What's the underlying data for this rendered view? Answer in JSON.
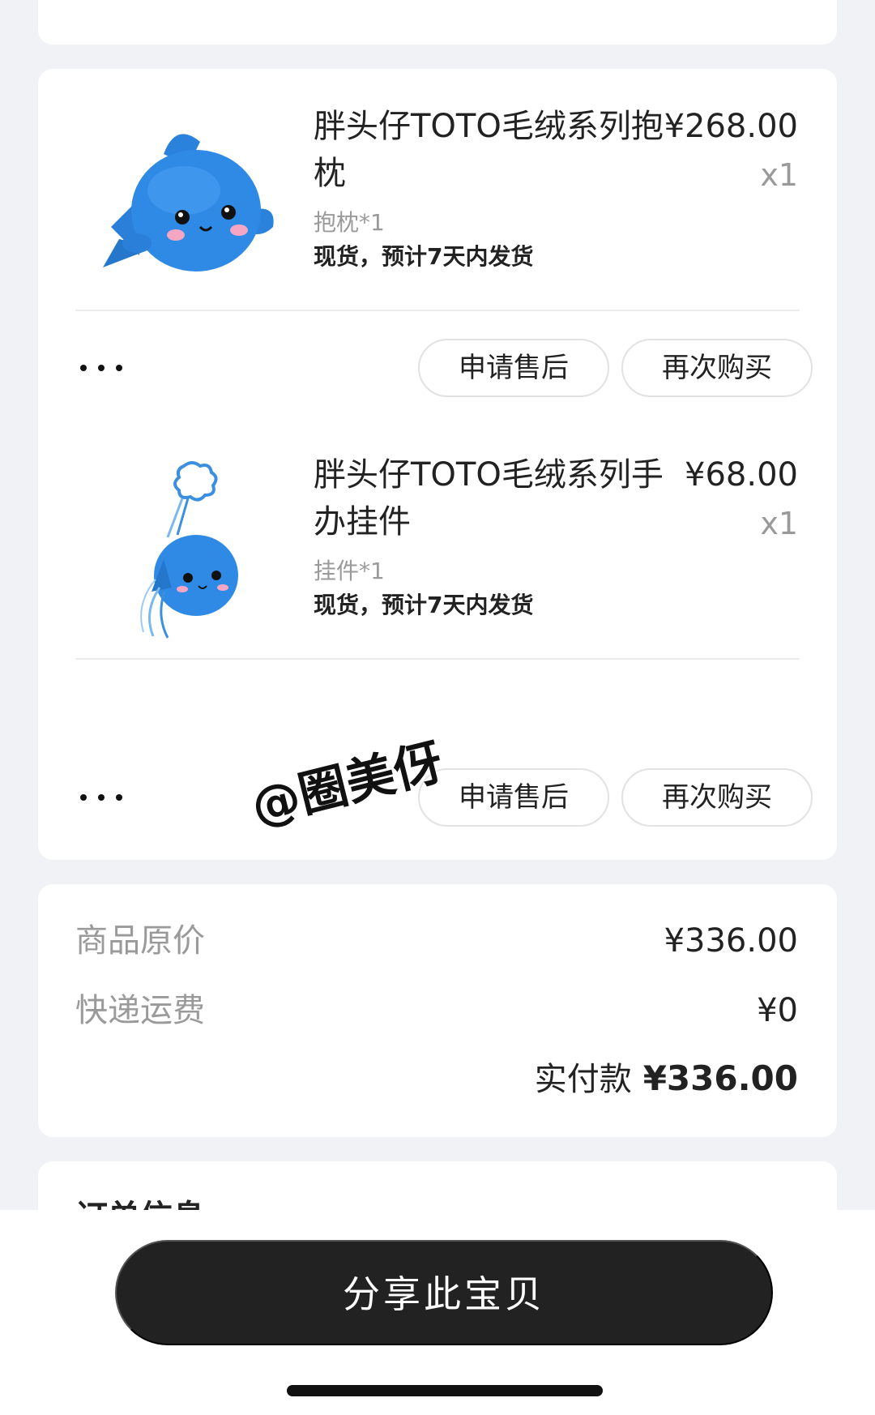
{
  "items": [
    {
      "title": "胖头仔TOTO毛绒系列抱枕",
      "price": "¥268.00",
      "qty": "x1",
      "sku": "抱枕*1",
      "shipping": "现货，预计7天内发货",
      "thumb_icon": "blue-fish-plush-pillow",
      "aftersale_label": "申请售后",
      "rebuy_label": "再次购买"
    },
    {
      "title": "胖头仔TOTO毛绒系列手办挂件",
      "price": "¥68.00",
      "qty": "x1",
      "sku": "挂件*1",
      "shipping": "现货，预计7天内发货",
      "thumb_icon": "blue-fish-plush-keychain",
      "aftersale_label": "申请售后",
      "rebuy_label": "再次购买"
    }
  ],
  "summary": {
    "original_price_label": "商品原价",
    "original_price_value": "¥336.00",
    "shipping_label": "快递运费",
    "shipping_value": "¥0",
    "paid_label": "实付款",
    "paid_value": "¥336.00"
  },
  "order_info": {
    "heading": "订单信息"
  },
  "share_button": {
    "label": "分享此宝贝"
  },
  "watermark": {
    "text": "@圈美伢"
  },
  "colors": {
    "page_bg": "#f0f2f5",
    "card_bg": "#ffffff",
    "primary_text": "#222222",
    "muted_text": "#9a9a9a",
    "button_dark": "#222222",
    "fish_blue": "#2f8ae6"
  }
}
